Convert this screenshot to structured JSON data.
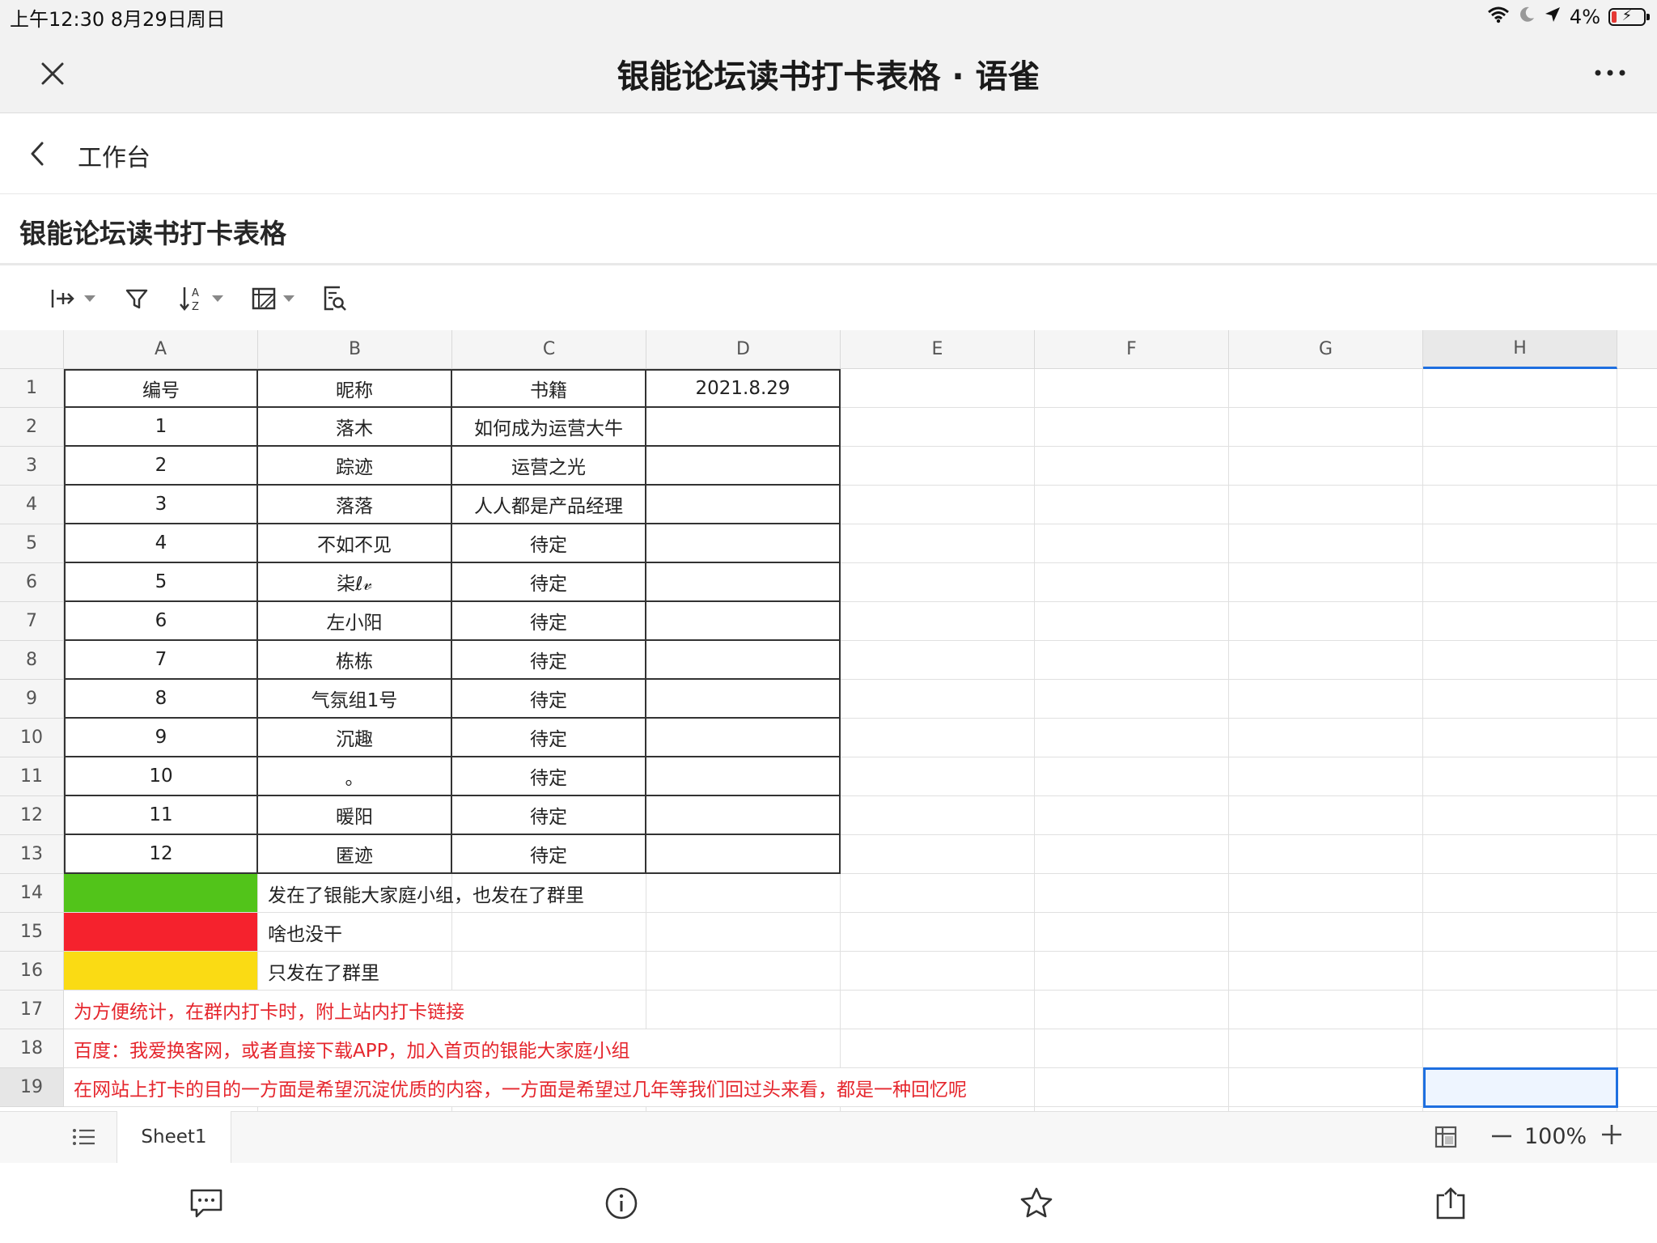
{
  "status_bar": {
    "time": "上午12:30   8月29日周日",
    "battery": "4%"
  },
  "window": {
    "title": "银能论坛读书打卡表格 · 语雀"
  },
  "breadcrumb": {
    "label": "工作台"
  },
  "document": {
    "title": "银能论坛读书打卡表格"
  },
  "colors": {
    "green": "#52c41a",
    "red": "#f5222d",
    "yellow": "#fadb14",
    "selection": "#1e6fe0",
    "note_text": "#e5262d"
  },
  "icons": {
    "toolbar": [
      "freeze-cols-icon",
      "filter-icon",
      "sort-az-icon",
      "cell-style-icon",
      "search-doc-icon"
    ],
    "nav": [
      "comment-icon",
      "info-icon",
      "star-icon",
      "share-icon"
    ]
  },
  "grid": {
    "columns": [
      "A",
      "B",
      "C",
      "D",
      "E",
      "F",
      "G",
      "H"
    ],
    "selected_column": "H",
    "selected_row": "19",
    "rows": [
      {
        "num": "1",
        "a": "编号",
        "b": "昵称",
        "c": "书籍",
        "d": "2021.8.29"
      },
      {
        "num": "2",
        "a": "1",
        "b": "落木",
        "c": "如何成为运营大牛",
        "d": ""
      },
      {
        "num": "3",
        "a": "2",
        "b": "踪迹",
        "c": "运营之光",
        "d": ""
      },
      {
        "num": "4",
        "a": "3",
        "b": "落落",
        "c": "人人都是产品经理",
        "d": ""
      },
      {
        "num": "5",
        "a": "4",
        "b": "不如不见",
        "c": "待定",
        "d": ""
      },
      {
        "num": "6",
        "a": "5",
        "b": "柒ℓ𝓋",
        "c": "待定",
        "d": ""
      },
      {
        "num": "7",
        "a": "6",
        "b": "左小阳",
        "c": "待定",
        "d": ""
      },
      {
        "num": "8",
        "a": "7",
        "b": "栋栋",
        "c": "待定",
        "d": ""
      },
      {
        "num": "9",
        "a": "8",
        "b": "气氛组1号",
        "c": "待定",
        "d": ""
      },
      {
        "num": "10",
        "a": "9",
        "b": "沉趣",
        "c": "待定",
        "d": ""
      },
      {
        "num": "11",
        "a": "10",
        "b": "。",
        "c": "待定",
        "d": ""
      },
      {
        "num": "12",
        "a": "11",
        "b": "暖阳",
        "c": "待定",
        "d": ""
      },
      {
        "num": "13",
        "a": "12",
        "b": "匿迹",
        "c": "待定",
        "d": ""
      }
    ],
    "legend": [
      {
        "num": "14",
        "color": "#52c41a",
        "text": "发在了银能大家庭小组，也发在了群里"
      },
      {
        "num": "15",
        "color": "#f5222d",
        "text": "啥也没干"
      },
      {
        "num": "16",
        "color": "#fadb14",
        "text": "只发在了群里"
      }
    ],
    "notes": [
      {
        "num": "17",
        "text": "为方便统计，在群内打卡时，附上站内打卡链接"
      },
      {
        "num": "18",
        "text": "百度：我爱换客网，或者直接下载APP，加入首页的银能大家庭小组"
      },
      {
        "num": "19",
        "text": "在网站上打卡的目的一方面是希望沉淀优质的内容，一方面是希望过几年等我们回过头来看，都是一种回忆呢"
      }
    ]
  },
  "sheet_bar": {
    "tab": "Sheet1",
    "zoom": "100%"
  }
}
